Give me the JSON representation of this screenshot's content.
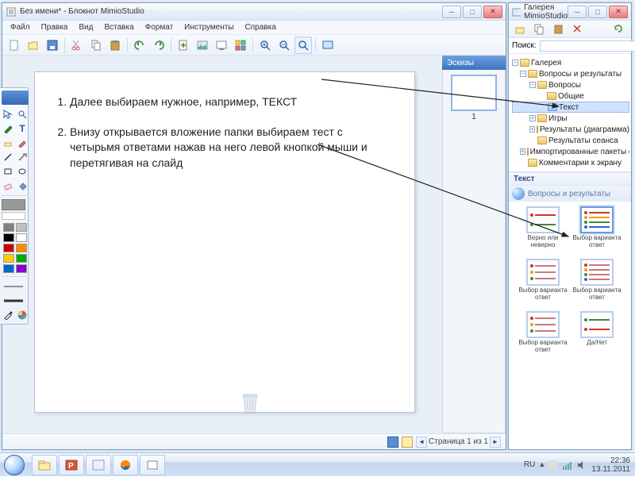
{
  "notepad": {
    "title": "Без имени* - Блокнот MimioStudio",
    "menu": [
      "Файл",
      "Правка",
      "Вид",
      "Вставка",
      "Формат",
      "Инструменты",
      "Справка"
    ],
    "thumbs_header": "Эскизы",
    "thumb_label": "1",
    "page_text": {
      "item1": "Далее выбираем нужное, например, ТЕКСТ",
      "item2": "Внизу открывается вложение папки выбираем тест с четырьмя ответами нажав на него левой кнопкой мыши и перетягивая на слайд"
    },
    "status": "Страница 1 из 1"
  },
  "gallery": {
    "title": "Галерея MimioStudio",
    "search_label": "Поиск:",
    "search_placeholder": "",
    "tree": {
      "root": "Галерея",
      "n1": "Вопросы и результаты",
      "n2": "Вопросы",
      "n3": "Общие",
      "n4": "Текст",
      "n5": "Игры",
      "n6": "Результаты (диаграмма)",
      "n7": "Результаты сеанса",
      "n8": "Импортированные пакеты содержимого",
      "n9": "Комментарии к экрану"
    },
    "section": "Текст",
    "voprosy": "Вопросы и результаты",
    "templates": [
      "Верно или неверно",
      "Выбор варианта ответ",
      "Выбор варианта ответ",
      "Выбор варианта ответ",
      "Выбор варианта ответ",
      "Да/Нет"
    ]
  },
  "taskbar": {
    "lang": "RU",
    "time": "22:36",
    "date": "13.11.2011"
  }
}
